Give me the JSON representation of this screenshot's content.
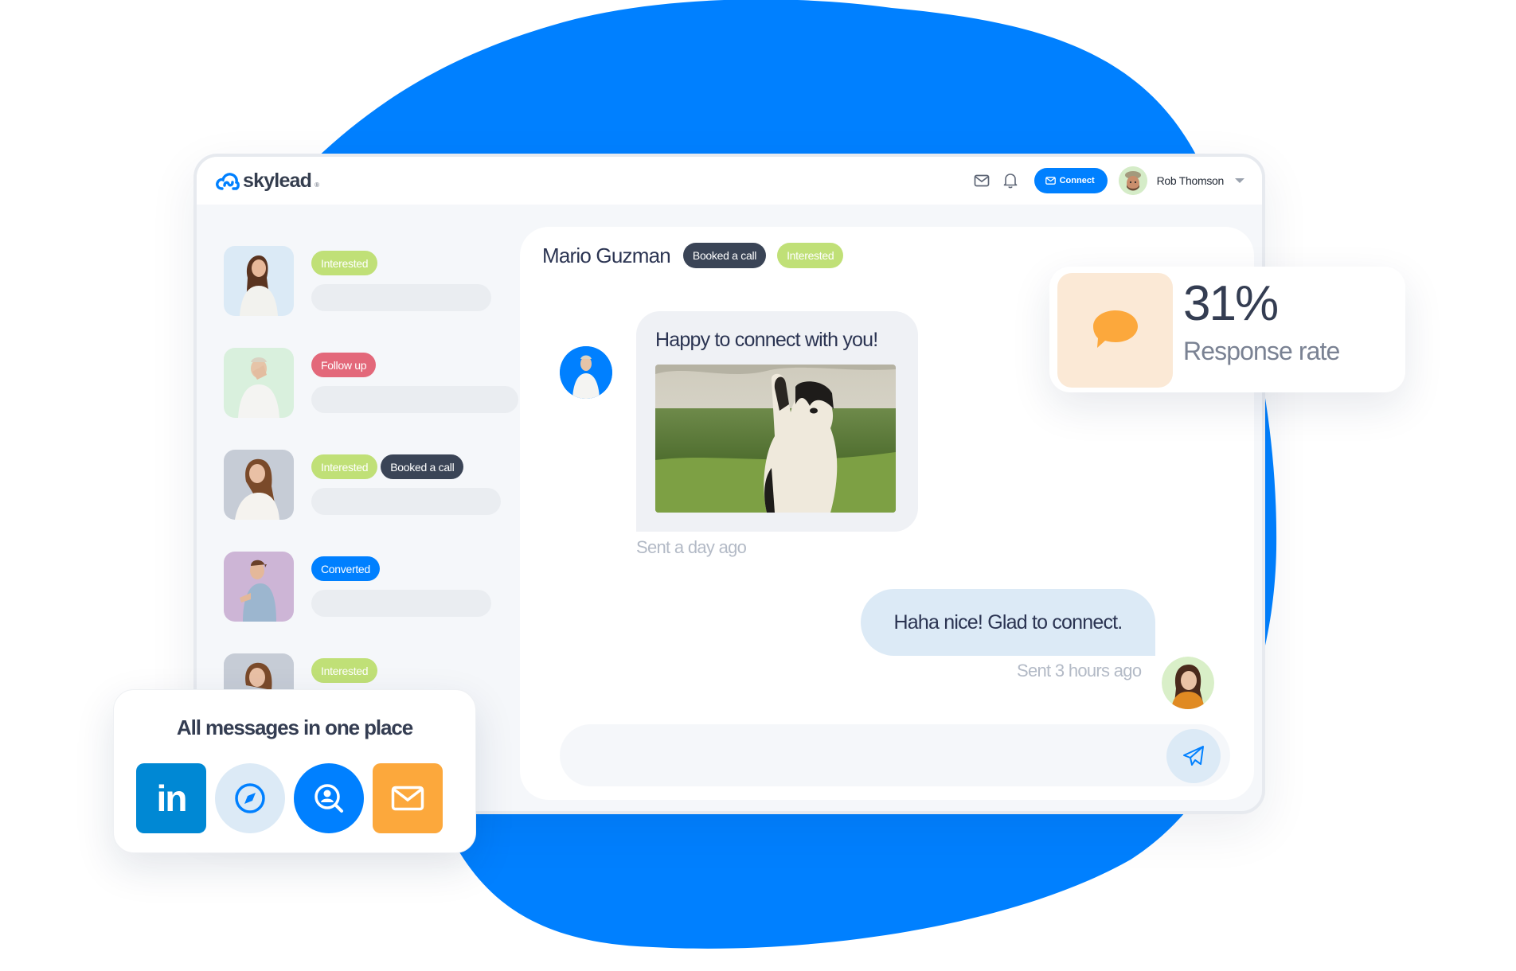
{
  "colors": {
    "brand_blue": "#0080ff",
    "interested": "#c0e077",
    "follow_up": "#e3687a",
    "booked": "#3a4456",
    "converted": "#0080ff",
    "stat_accent": "#fca83c",
    "linkedin": "#0088d4"
  },
  "header": {
    "logo_text": "skylead",
    "logo_mark": "®",
    "mail_icon": "envelope-icon",
    "bell_icon": "bell-icon",
    "connect_label": "Connect",
    "user_name": "Rob Thomson"
  },
  "leads": [
    {
      "tags": [
        "Interested"
      ],
      "photo_bg": "#dbeaf6"
    },
    {
      "tags": [
        "Follow up"
      ],
      "photo_bg": "#d9f0dd"
    },
    {
      "tags": [
        "Interested",
        "Booked a call"
      ],
      "photo_bg": "#c6ccd6"
    },
    {
      "tags": [
        "Converted"
      ],
      "photo_bg": "#cdb5d6"
    },
    {
      "tags": [
        "Interested"
      ],
      "photo_bg": "#c6ccd6"
    }
  ],
  "chat": {
    "contact_name": "Mario Guzman",
    "contact_tags": [
      "Booked a call",
      "Interested"
    ],
    "messages": [
      {
        "direction": "incoming",
        "text": "Happy to connect with you!",
        "attachment": "dog-waving-photo",
        "timestamp": "Sent a day ago"
      },
      {
        "direction": "outgoing",
        "text": "Haha nice! Glad to connect.",
        "timestamp": "Sent 3 hours ago"
      }
    ],
    "composer_value": "",
    "send_icon": "paper-plane-icon"
  },
  "stat": {
    "value": "31%",
    "label": "Response rate",
    "icon": "chat-bubble-icon"
  },
  "channels": {
    "title": "All messages in one place",
    "items": [
      {
        "name": "LinkedIn",
        "icon": "linkedin-icon",
        "glyph": "in"
      },
      {
        "name": "Sales Navigator",
        "icon": "compass-icon"
      },
      {
        "name": "Recruiter",
        "icon": "person-search-icon"
      },
      {
        "name": "Email",
        "icon": "envelope-icon"
      }
    ]
  }
}
